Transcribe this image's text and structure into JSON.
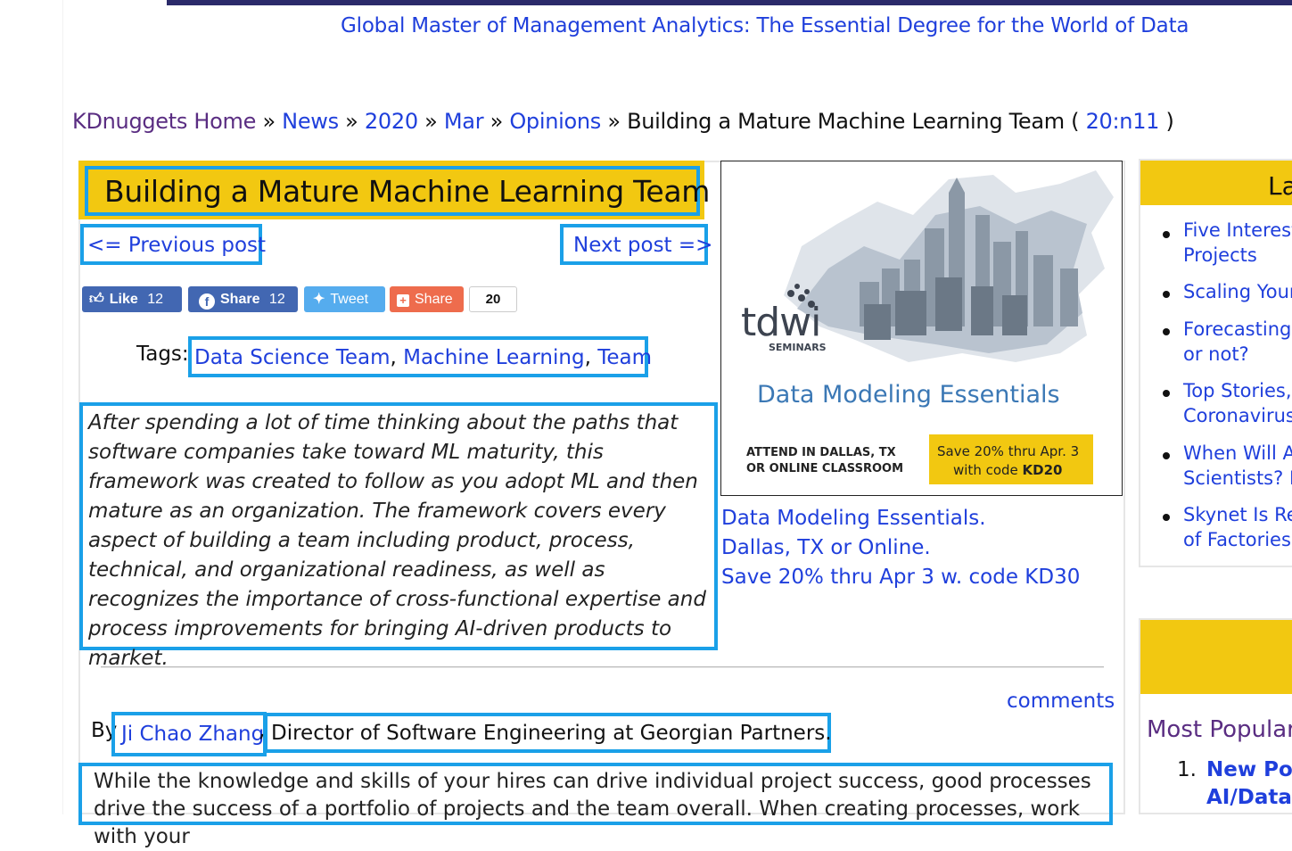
{
  "promo": {
    "text": "Global Master of Management Analytics: The Essential Degree for the World of Data"
  },
  "breadcrumb": {
    "home": "KDnuggets Home",
    "sep": "»",
    "news": "News",
    "year": "2020",
    "month": "Mar",
    "section": "Opinions",
    "current": "Building a Mature Machine Learning Team (",
    "issue": "20:n11",
    "close": ")"
  },
  "article": {
    "title": "Building a Mature Machine Learning Team",
    "prev": "<= Previous post",
    "next": "Next post =>",
    "tags_label": "Tags:",
    "tags": [
      "Data Science Team",
      "Machine Learning",
      "Team"
    ],
    "excerpt": "After spending a lot of time thinking about the paths that software companies take toward ML maturity, this framework was created to follow as you adopt ML and then mature as an organization. The framework covers every aspect of building a team including product, process, technical, and organizational readiness, as well as recognizes the importance of cross-functional expertise and process improvements for bringing AI-driven products to market.",
    "comments": "comments",
    "by": "By",
    "author": "Ji Chao Zhang",
    "role": "Director of Software Engineering at Georgian Partners",
    "role_end": ".",
    "body": "While the knowledge and skills of your hires can drive individual project success, good processes drive the success of a portfolio of projects and the team overall. When creating processes, work with your"
  },
  "social": {
    "like": "Like",
    "like_count": "12",
    "share": "Share",
    "share_count": "12",
    "tweet": "Tweet",
    "share2": "Share",
    "total": "20"
  },
  "ad": {
    "brand": "tdwi",
    "brand_sub": "SEMINARS",
    "headline": "Data Modeling Essentials",
    "attend": "ATTEND IN DALLAS, TX\nOR ONLINE CLASSROOM",
    "save1": "Save 20% thru Apr. 3",
    "save2_pre": "with code ",
    "save2_code": "KD20",
    "caption": [
      "Data Modeling Essentials.",
      "Dallas, TX or Online.",
      "Save 20% thru Apr 3 w. code KD30"
    ],
    "colors": {
      "headline": "#3b78b5",
      "save_bg": "#f2c811"
    }
  },
  "sidebar": {
    "latest_title": "La",
    "items": [
      [
        "Five Interesti",
        "Projects"
      ],
      [
        "Scaling Your"
      ],
      [
        "Forecasting S",
        "or not?"
      ],
      [
        "Top Stories,",
        "Coronavirus"
      ],
      [
        "When Will Au",
        "Scientists? Po"
      ],
      [
        "Skynet Is Rea",
        "of Factories V"
      ]
    ],
    "most_popular": "Most Popular",
    "popular_num": "1.",
    "popular_first": [
      "New Poll",
      "AI/Data S"
    ]
  },
  "colors": {
    "accent": "#f2c811",
    "link": "#1f3fdc",
    "highlight": "#1aa0e8",
    "facebook": "#4267b2",
    "twitter": "#55acee",
    "addthis": "#ee6c4d"
  }
}
